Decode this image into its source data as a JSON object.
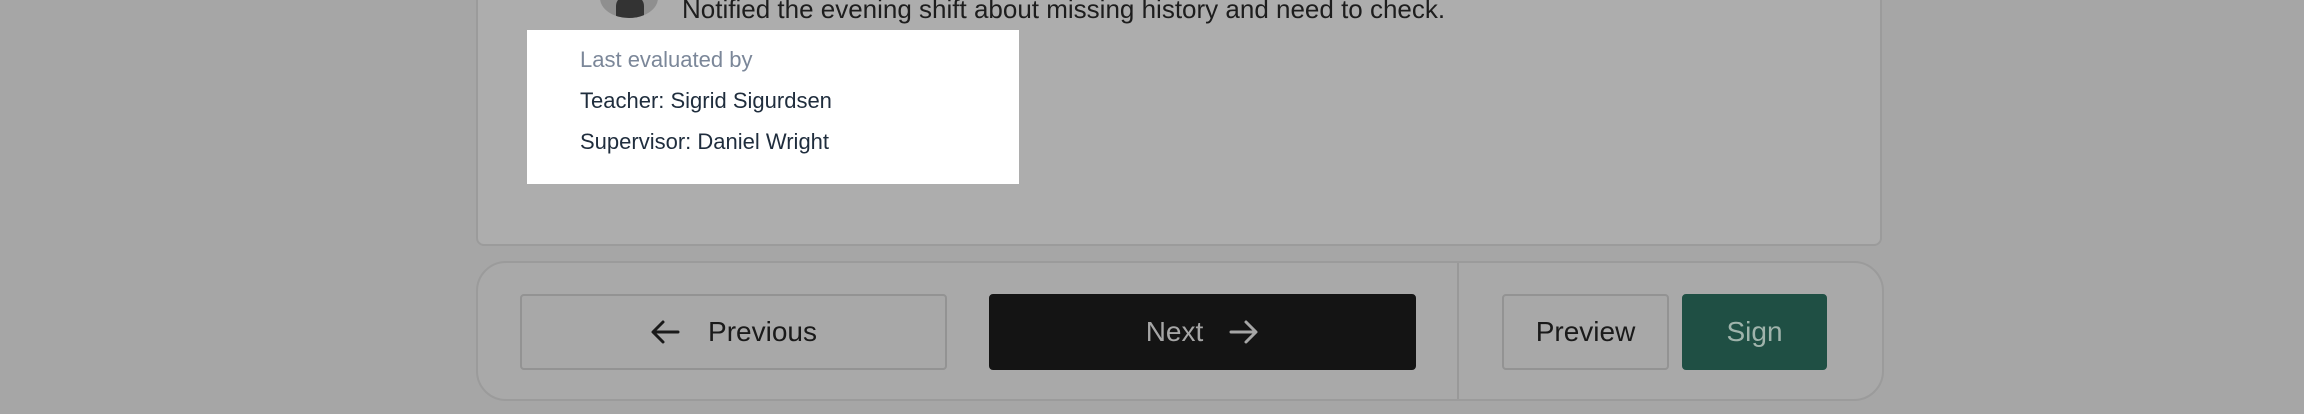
{
  "activity": {
    "note": "Notified the evening shift about missing history and need to check."
  },
  "evaluation_popover": {
    "heading": "Last evaluated by",
    "teacher": "Teacher: Sigrid Sigurdsen",
    "supervisor": "Supervisor: Daniel Wright"
  },
  "actions": {
    "previous_label": "Previous",
    "next_label": "Next",
    "preview_label": "Preview",
    "sign_label": "Sign"
  },
  "icons": {
    "previous": "arrow-left-icon",
    "next": "arrow-right-icon"
  },
  "colors": {
    "overlay": "#a6a6a6",
    "next_button": "#141414",
    "sign_button": "#1f4f44",
    "popover_background": "#ffffff",
    "popover_heading": "#7b8799",
    "popover_text": "#1f2d3d"
  }
}
